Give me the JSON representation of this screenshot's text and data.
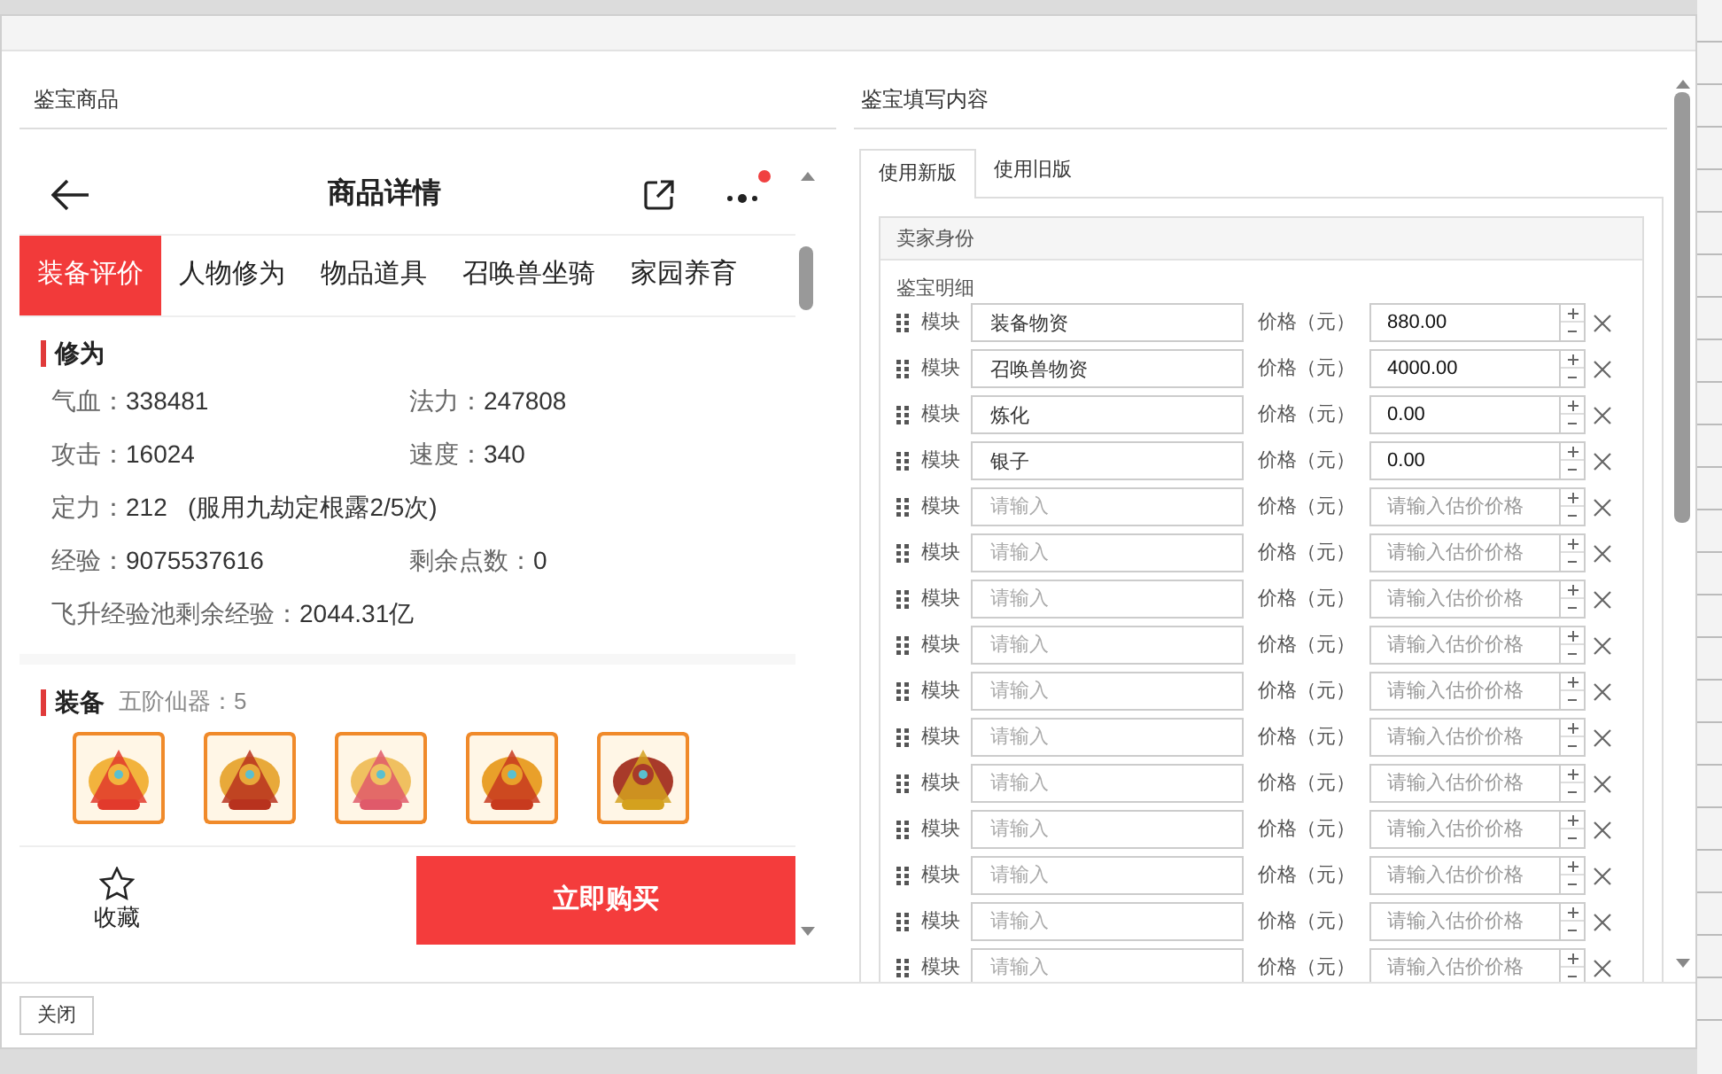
{
  "left_panel": {
    "title": "鉴宝商品",
    "phone": {
      "title": "商品详情",
      "notification_dot": true,
      "tabs": [
        {
          "label": "装备评价",
          "selected": true
        },
        {
          "label": "人物修为",
          "selected": false
        },
        {
          "label": "物品道具",
          "selected": false
        },
        {
          "label": "召唤兽坐骑",
          "selected": false
        },
        {
          "label": "家园养育",
          "selected": false
        }
      ],
      "cultivation": {
        "heading": "修为",
        "stats": [
          {
            "label": "气血：",
            "value": "338481",
            "wide": false
          },
          {
            "label": "法力：",
            "value": "247808",
            "wide": false
          },
          {
            "label": "攻击：",
            "value": "16024",
            "wide": false
          },
          {
            "label": "速度：",
            "value": "340",
            "wide": false
          },
          {
            "label": "定力：",
            "value": "212   (服用九劫定根露2/5次)",
            "wide": true
          },
          {
            "label": "经验：",
            "value": "9075537616",
            "wide": false
          },
          {
            "label": "剩余点数：",
            "value": "0",
            "wide": false
          },
          {
            "label": "飞升经验池剩余经验：",
            "value": "2044.31亿",
            "wide": true
          }
        ]
      },
      "equipment": {
        "heading": "装备",
        "note": "五阶仙器：5"
      },
      "favorite": "收藏",
      "buy_button": "立即购买"
    }
  },
  "right_panel": {
    "title": "鉴宝填写内容",
    "tabs": [
      {
        "label": "使用新版",
        "selected": true
      },
      {
        "label": "使用旧版",
        "selected": false
      }
    ],
    "seller_header": "卖家身份",
    "details_label": "鉴宝明细",
    "rows": [
      {
        "label": "模块",
        "module": "装备物资",
        "price_label": "价格（元）",
        "price": "880.00"
      },
      {
        "label": "模块",
        "module": "召唤兽物资",
        "price_label": "价格（元）",
        "price": "4000.00"
      },
      {
        "label": "模块",
        "module": "炼化",
        "price_label": "价格（元）",
        "price": "0.00"
      },
      {
        "label": "模块",
        "module": "银子",
        "price_label": "价格（元）",
        "price": "0.00"
      },
      {
        "label": "模块",
        "module_placeholder": "请输入",
        "price_label": "价格（元）",
        "price_placeholder": "请输入估价价格"
      },
      {
        "label": "模块",
        "module_placeholder": "请输入",
        "price_label": "价格（元）",
        "price_placeholder": "请输入估价价格"
      },
      {
        "label": "模块",
        "module_placeholder": "请输入",
        "price_label": "价格（元）",
        "price_placeholder": "请输入估价价格"
      },
      {
        "label": "模块",
        "module_placeholder": "请输入",
        "price_label": "价格（元）",
        "price_placeholder": "请输入估价价格"
      },
      {
        "label": "模块",
        "module_placeholder": "请输入",
        "price_label": "价格（元）",
        "price_placeholder": "请输入估价价格"
      },
      {
        "label": "模块",
        "module_placeholder": "请输入",
        "price_label": "价格（元）",
        "price_placeholder": "请输入估价价格"
      },
      {
        "label": "模块",
        "module_placeholder": "请输入",
        "price_label": "价格（元）",
        "price_placeholder": "请输入估价价格"
      },
      {
        "label": "模块",
        "module_placeholder": "请输入",
        "price_label": "价格（元）",
        "price_placeholder": "请输入估价价格"
      },
      {
        "label": "模块",
        "module_placeholder": "请输入",
        "price_label": "价格（元）",
        "price_placeholder": "请输入估价价格"
      },
      {
        "label": "模块",
        "module_placeholder": "请输入",
        "price_label": "价格（元）",
        "price_placeholder": "请输入估价价格"
      },
      {
        "label": "模块",
        "module_placeholder": "请输入",
        "price_label": "价格（元）",
        "price_placeholder": "请输入估价价格"
      }
    ]
  },
  "footer": {
    "close_button": "关闭"
  }
}
